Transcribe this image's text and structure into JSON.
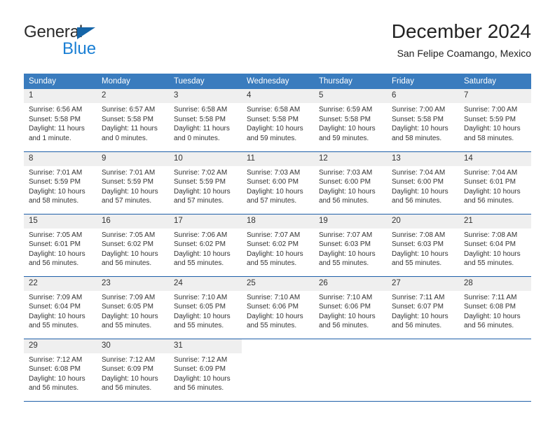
{
  "logo": {
    "word_one": "General",
    "word_two": "Blue",
    "triangle_icon": "blue-triangle-icon",
    "brand_dark": "#2b2b2b",
    "brand_blue": "#1a7fd4",
    "triangle_color": "#1565a8"
  },
  "header": {
    "title": "December 2024",
    "subtitle": "San Felipe Coamango, Mexico"
  },
  "colors": {
    "header_bg": "#3a7cbe",
    "header_text": "#ffffff",
    "row_divider": "#1f5fa9",
    "daynum_bg": "#efefef",
    "body_text": "#333333"
  },
  "calendar": {
    "weekday_headers": [
      "Sunday",
      "Monday",
      "Tuesday",
      "Wednesday",
      "Thursday",
      "Friday",
      "Saturday"
    ],
    "weeks": [
      [
        {
          "day": "1",
          "sunrise": "Sunrise: 6:56 AM",
          "sunset": "Sunset: 5:58 PM",
          "daylight": "Daylight: 11 hours and 1 minute."
        },
        {
          "day": "2",
          "sunrise": "Sunrise: 6:57 AM",
          "sunset": "Sunset: 5:58 PM",
          "daylight": "Daylight: 11 hours and 0 minutes."
        },
        {
          "day": "3",
          "sunrise": "Sunrise: 6:58 AM",
          "sunset": "Sunset: 5:58 PM",
          "daylight": "Daylight: 11 hours and 0 minutes."
        },
        {
          "day": "4",
          "sunrise": "Sunrise: 6:58 AM",
          "sunset": "Sunset: 5:58 PM",
          "daylight": "Daylight: 10 hours and 59 minutes."
        },
        {
          "day": "5",
          "sunrise": "Sunrise: 6:59 AM",
          "sunset": "Sunset: 5:58 PM",
          "daylight": "Daylight: 10 hours and 59 minutes."
        },
        {
          "day": "6",
          "sunrise": "Sunrise: 7:00 AM",
          "sunset": "Sunset: 5:58 PM",
          "daylight": "Daylight: 10 hours and 58 minutes."
        },
        {
          "day": "7",
          "sunrise": "Sunrise: 7:00 AM",
          "sunset": "Sunset: 5:59 PM",
          "daylight": "Daylight: 10 hours and 58 minutes."
        }
      ],
      [
        {
          "day": "8",
          "sunrise": "Sunrise: 7:01 AM",
          "sunset": "Sunset: 5:59 PM",
          "daylight": "Daylight: 10 hours and 58 minutes."
        },
        {
          "day": "9",
          "sunrise": "Sunrise: 7:01 AM",
          "sunset": "Sunset: 5:59 PM",
          "daylight": "Daylight: 10 hours and 57 minutes."
        },
        {
          "day": "10",
          "sunrise": "Sunrise: 7:02 AM",
          "sunset": "Sunset: 5:59 PM",
          "daylight": "Daylight: 10 hours and 57 minutes."
        },
        {
          "day": "11",
          "sunrise": "Sunrise: 7:03 AM",
          "sunset": "Sunset: 6:00 PM",
          "daylight": "Daylight: 10 hours and 57 minutes."
        },
        {
          "day": "12",
          "sunrise": "Sunrise: 7:03 AM",
          "sunset": "Sunset: 6:00 PM",
          "daylight": "Daylight: 10 hours and 56 minutes."
        },
        {
          "day": "13",
          "sunrise": "Sunrise: 7:04 AM",
          "sunset": "Sunset: 6:00 PM",
          "daylight": "Daylight: 10 hours and 56 minutes."
        },
        {
          "day": "14",
          "sunrise": "Sunrise: 7:04 AM",
          "sunset": "Sunset: 6:01 PM",
          "daylight": "Daylight: 10 hours and 56 minutes."
        }
      ],
      [
        {
          "day": "15",
          "sunrise": "Sunrise: 7:05 AM",
          "sunset": "Sunset: 6:01 PM",
          "daylight": "Daylight: 10 hours and 56 minutes."
        },
        {
          "day": "16",
          "sunrise": "Sunrise: 7:05 AM",
          "sunset": "Sunset: 6:02 PM",
          "daylight": "Daylight: 10 hours and 56 minutes."
        },
        {
          "day": "17",
          "sunrise": "Sunrise: 7:06 AM",
          "sunset": "Sunset: 6:02 PM",
          "daylight": "Daylight: 10 hours and 55 minutes."
        },
        {
          "day": "18",
          "sunrise": "Sunrise: 7:07 AM",
          "sunset": "Sunset: 6:02 PM",
          "daylight": "Daylight: 10 hours and 55 minutes."
        },
        {
          "day": "19",
          "sunrise": "Sunrise: 7:07 AM",
          "sunset": "Sunset: 6:03 PM",
          "daylight": "Daylight: 10 hours and 55 minutes."
        },
        {
          "day": "20",
          "sunrise": "Sunrise: 7:08 AM",
          "sunset": "Sunset: 6:03 PM",
          "daylight": "Daylight: 10 hours and 55 minutes."
        },
        {
          "day": "21",
          "sunrise": "Sunrise: 7:08 AM",
          "sunset": "Sunset: 6:04 PM",
          "daylight": "Daylight: 10 hours and 55 minutes."
        }
      ],
      [
        {
          "day": "22",
          "sunrise": "Sunrise: 7:09 AM",
          "sunset": "Sunset: 6:04 PM",
          "daylight": "Daylight: 10 hours and 55 minutes."
        },
        {
          "day": "23",
          "sunrise": "Sunrise: 7:09 AM",
          "sunset": "Sunset: 6:05 PM",
          "daylight": "Daylight: 10 hours and 55 minutes."
        },
        {
          "day": "24",
          "sunrise": "Sunrise: 7:10 AM",
          "sunset": "Sunset: 6:05 PM",
          "daylight": "Daylight: 10 hours and 55 minutes."
        },
        {
          "day": "25",
          "sunrise": "Sunrise: 7:10 AM",
          "sunset": "Sunset: 6:06 PM",
          "daylight": "Daylight: 10 hours and 55 minutes."
        },
        {
          "day": "26",
          "sunrise": "Sunrise: 7:10 AM",
          "sunset": "Sunset: 6:06 PM",
          "daylight": "Daylight: 10 hours and 56 minutes."
        },
        {
          "day": "27",
          "sunrise": "Sunrise: 7:11 AM",
          "sunset": "Sunset: 6:07 PM",
          "daylight": "Daylight: 10 hours and 56 minutes."
        },
        {
          "day": "28",
          "sunrise": "Sunrise: 7:11 AM",
          "sunset": "Sunset: 6:08 PM",
          "daylight": "Daylight: 10 hours and 56 minutes."
        }
      ],
      [
        {
          "day": "29",
          "sunrise": "Sunrise: 7:12 AM",
          "sunset": "Sunset: 6:08 PM",
          "daylight": "Daylight: 10 hours and 56 minutes."
        },
        {
          "day": "30",
          "sunrise": "Sunrise: 7:12 AM",
          "sunset": "Sunset: 6:09 PM",
          "daylight": "Daylight: 10 hours and 56 minutes."
        },
        {
          "day": "31",
          "sunrise": "Sunrise: 7:12 AM",
          "sunset": "Sunset: 6:09 PM",
          "daylight": "Daylight: 10 hours and 56 minutes."
        },
        {
          "day": "",
          "sunrise": "",
          "sunset": "",
          "daylight": ""
        },
        {
          "day": "",
          "sunrise": "",
          "sunset": "",
          "daylight": ""
        },
        {
          "day": "",
          "sunrise": "",
          "sunset": "",
          "daylight": ""
        },
        {
          "day": "",
          "sunrise": "",
          "sunset": "",
          "daylight": ""
        }
      ]
    ]
  }
}
